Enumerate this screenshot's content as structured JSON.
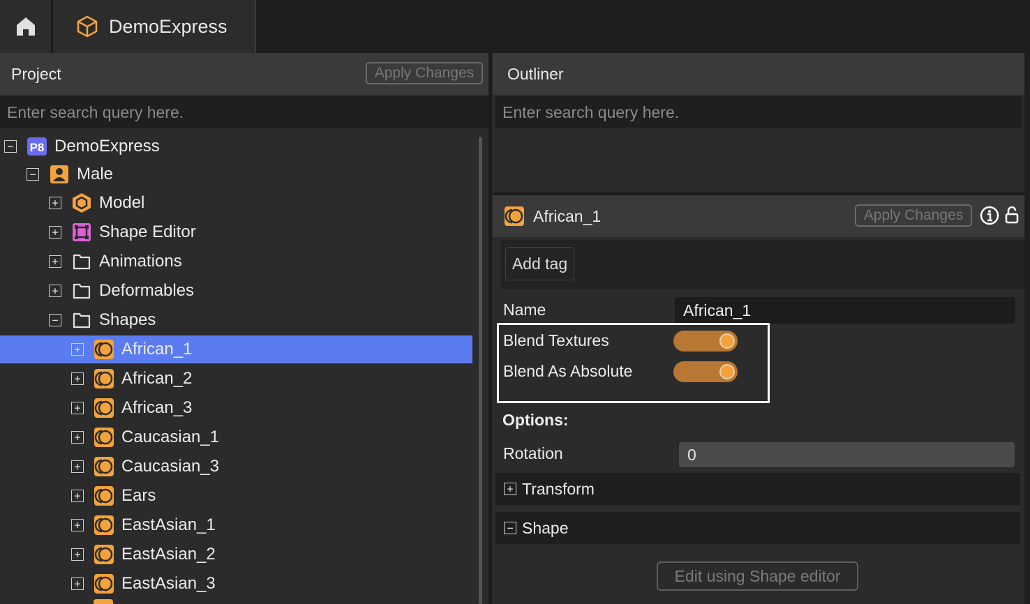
{
  "app_tab": {
    "title": "DemoExpress"
  },
  "project_panel": {
    "title": "Project",
    "apply_label": "Apply Changes",
    "search_placeholder": "Enter search query here."
  },
  "tree": [
    {
      "label": "DemoExpress",
      "expander": "−",
      "icon": "p8-project-icon"
    },
    {
      "label": "Male",
      "expander": "−",
      "icon": "character-icon"
    },
    {
      "label": "Model",
      "expander": "+",
      "icon": "model-hexagon-icon"
    },
    {
      "label": "Shape Editor",
      "expander": "+",
      "icon": "shape-editor-icon"
    },
    {
      "label": "Animations",
      "expander": "+",
      "icon": "folder-icon"
    },
    {
      "label": "Deformables",
      "expander": "+",
      "icon": "folder-icon"
    },
    {
      "label": "Shapes",
      "expander": "−",
      "icon": "folder-icon"
    },
    {
      "label": "African_1",
      "expander": "+",
      "icon": "blend-shape-icon",
      "selected": true
    },
    {
      "label": "African_2",
      "expander": "+",
      "icon": "blend-shape-icon"
    },
    {
      "label": "African_3",
      "expander": "+",
      "icon": "blend-shape-icon"
    },
    {
      "label": "Caucasian_1",
      "expander": "+",
      "icon": "blend-shape-icon"
    },
    {
      "label": "Caucasian_3",
      "expander": "+",
      "icon": "blend-shape-icon"
    },
    {
      "label": "Ears",
      "expander": "+",
      "icon": "blend-shape-icon"
    },
    {
      "label": "EastAsian_1",
      "expander": "+",
      "icon": "blend-shape-icon"
    },
    {
      "label": "EastAsian_2",
      "expander": "+",
      "icon": "blend-shape-icon"
    },
    {
      "label": "EastAsian_3",
      "expander": "+",
      "icon": "blend-shape-icon"
    }
  ],
  "outliner_panel": {
    "title": "Outliner",
    "search_placeholder": "Enter search query here."
  },
  "properties": {
    "title": "African_1",
    "apply_label": "Apply Changes",
    "add_tag_label": "Add tag",
    "name_label": "Name",
    "name_value": "African_1",
    "blend_textures_label": "Blend Textures",
    "blend_textures_on": true,
    "blend_absolute_label": "Blend As Absolute",
    "blend_absolute_on": true,
    "options_label": "Options:",
    "rotation_label": "Rotation",
    "rotation_value": "0",
    "transform_label": "Transform",
    "transform_expander": "+",
    "shape_label": "Shape",
    "shape_expander": "−",
    "edit_shape_label": "Edit using Shape editor"
  },
  "colors": {
    "accent_orange": "#f4a33c",
    "selection_blue": "#5b7cf0",
    "p8_badge": "#6a6cf0",
    "shape_editor_pink": "#e060d8"
  }
}
